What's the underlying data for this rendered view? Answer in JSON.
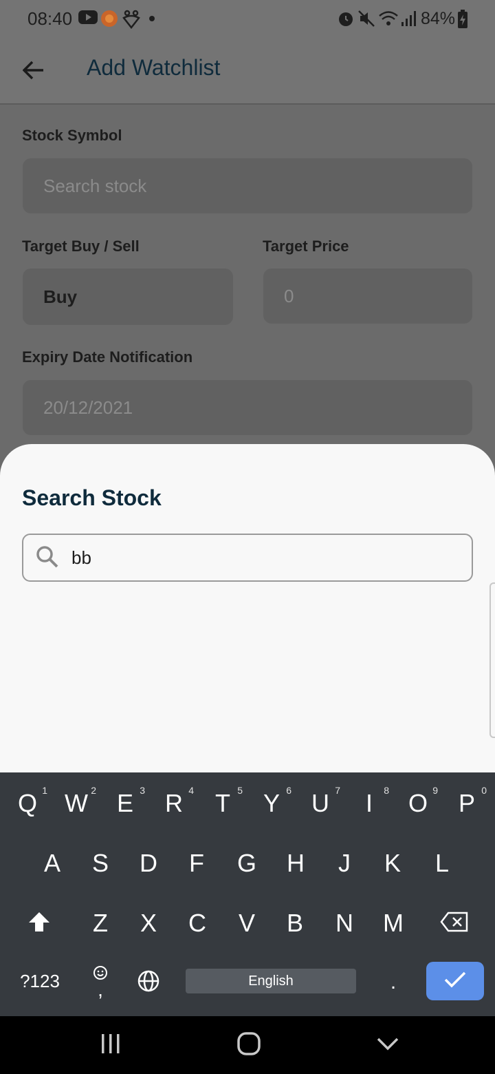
{
  "status_bar": {
    "time": "08:40",
    "battery": "84%",
    "icons": [
      "youtube-icon",
      "app-badge-icon",
      "heart-paw-icon",
      "dot-icon",
      "alarm-icon",
      "mute-icon",
      "wifi-icon",
      "signal-icon",
      "battery-charging-icon"
    ]
  },
  "app_bar": {
    "back_icon": "arrow-left-icon",
    "title": "Add Watchlist"
  },
  "form": {
    "stock_symbol": {
      "label": "Stock Symbol",
      "placeholder": "Search stock"
    },
    "target_buy_sell": {
      "label": "Target Buy / Sell",
      "value": "Buy"
    },
    "target_price": {
      "label": "Target Price",
      "value": "0"
    },
    "expiry": {
      "label": "Expiry Date Notification",
      "value": "20/12/2021"
    }
  },
  "sheet": {
    "title": "Search Stock",
    "search_value": "bb",
    "search_icon": "search-icon"
  },
  "keyboard": {
    "row1": [
      {
        "key": "Q",
        "num": "1"
      },
      {
        "key": "W",
        "num": "2"
      },
      {
        "key": "E",
        "num": "3"
      },
      {
        "key": "R",
        "num": "4"
      },
      {
        "key": "T",
        "num": "5"
      },
      {
        "key": "Y",
        "num": "6"
      },
      {
        "key": "U",
        "num": "7"
      },
      {
        "key": "I",
        "num": "8"
      },
      {
        "key": "O",
        "num": "9"
      },
      {
        "key": "P",
        "num": "0"
      }
    ],
    "row2": [
      "A",
      "S",
      "D",
      "F",
      "G",
      "H",
      "J",
      "K",
      "L"
    ],
    "row3": [
      "Z",
      "X",
      "C",
      "V",
      "B",
      "N",
      "M"
    ],
    "symbols_label": "?123",
    "comma_label": ",",
    "space_label": "English",
    "period_label": ".",
    "accent_color": "#5c8fe8"
  },
  "nav_bar": {
    "icons": [
      "recent-apps-icon",
      "home-icon",
      "back-chevron-icon"
    ]
  }
}
